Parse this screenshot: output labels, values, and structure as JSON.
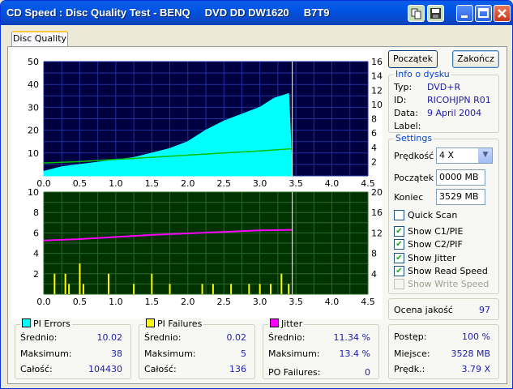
{
  "window": {
    "title": "CD Speed : Disc Quality Test - BENQ     DVD DD DW1620     B7T9"
  },
  "tab": {
    "label": "Disc Quality"
  },
  "buttons": {
    "start": "Początek",
    "stop": "Zakończ"
  },
  "disc_info": {
    "legend": "Info o dysku",
    "type_label": "Typ:",
    "type": "DVD+R",
    "id_label": "ID:",
    "id": "RICOHJPN R01",
    "date_label": "Data:",
    "date": "9 April 2004",
    "label_label": "Label:",
    "label": ""
  },
  "settings": {
    "legend": "Settings",
    "speed_label": "Prędkość",
    "speed": "4 X",
    "start_label": "Początek",
    "start": "0000 MB",
    "end_label": "Koniec",
    "end": "3529 MB",
    "quick_scan": "Quick Scan",
    "show_c1pie": "Show C1/PIE",
    "show_c2pif": "Show C2/PIF",
    "show_jitter": "Show Jitter",
    "show_read_speed": "Show Read Speed",
    "show_write_speed": "Show Write Speed"
  },
  "quality": {
    "label": "Ocena jakość",
    "value": "97"
  },
  "progress": {
    "progress_label": "Postęp:",
    "progress": "100 %",
    "position_label": "Miejsce:",
    "position": "3528 MB",
    "speed_label": "Prędk.:",
    "speed": "3.79 X"
  },
  "stats": {
    "pi_errors": {
      "legend": "PI Errors",
      "avg_label": "Średnio:",
      "avg": "10.02",
      "max_label": "Maksimum:",
      "max": "38",
      "total_label": "Całość:",
      "total": "104430"
    },
    "pi_failures": {
      "legend": "PI Failures",
      "avg_label": "Średnio:",
      "avg": "0.02",
      "max_label": "Maksimum:",
      "max": "5",
      "total_label": "Całość:",
      "total": "136"
    },
    "jitter": {
      "legend": "Jitter",
      "avg_label": "Średnio:",
      "avg": "11.34 %",
      "max_label": "Maksimum:",
      "max": "13.4 %",
      "po_label": "PO Failures:",
      "po": "0"
    }
  },
  "colors": {
    "pie": "#00ffff",
    "pif": "#ffff00",
    "jitter": "#ff00ff",
    "speed": "#00c000",
    "graph1_bg": "#000040",
    "graph2_bg": "#003300"
  },
  "chart_data": [
    {
      "type": "area",
      "x_ticks": [
        "0.0",
        "0.5",
        "1.0",
        "1.5",
        "2.0",
        "2.5",
        "3.0",
        "3.5",
        "4.0",
        "4.5"
      ],
      "y_left_ticks": [
        "50",
        "40",
        "30",
        "20",
        "10"
      ],
      "y_right_ticks": [
        "16",
        "14",
        "12",
        "10",
        "8",
        "6",
        "4",
        "2"
      ],
      "xlim": [
        0,
        4.5
      ],
      "ylim": [
        0,
        50
      ],
      "y2lim": [
        0,
        16
      ],
      "series": [
        {
          "values": [
            [
              0,
              2
            ],
            [
              0.25,
              4
            ],
            [
              0.5,
              5
            ],
            [
              0.75,
              6
            ],
            [
              1.0,
              7
            ],
            [
              1.25,
              8
            ],
            [
              1.5,
              10
            ],
            [
              1.75,
              12
            ],
            [
              2.0,
              15
            ],
            [
              2.25,
              20
            ],
            [
              2.5,
              24
            ],
            [
              2.75,
              27
            ],
            [
              3.0,
              30
            ],
            [
              3.2,
              34
            ],
            [
              3.4,
              36
            ],
            [
              3.45,
              0
            ]
          ]
        },
        {
          "values": [
            [
              0,
              1.8
            ],
            [
              0.5,
              2.0
            ],
            [
              1.0,
              2.3
            ],
            [
              1.5,
              2.6
            ],
            [
              2.0,
              2.9
            ],
            [
              2.5,
              3.2
            ],
            [
              3.0,
              3.5
            ],
            [
              3.45,
              3.8
            ]
          ]
        }
      ]
    },
    {
      "type": "line",
      "x_ticks": [
        "0.0",
        "0.5",
        "1.0",
        "1.5",
        "2.0",
        "2.5",
        "3.0",
        "3.5",
        "4.0",
        "4.5"
      ],
      "y_left_ticks": [
        "10",
        "8",
        "6",
        "4",
        "2"
      ],
      "y_right_ticks": [
        "20",
        "16",
        "12",
        "8",
        "4"
      ],
      "xlim": [
        0,
        4.5
      ],
      "ylim": [
        0,
        10
      ],
      "y2lim": [
        0,
        20
      ],
      "series": [
        {
          "values": [
            [
              0.15,
              2
            ],
            [
              0.3,
              2
            ],
            [
              0.35,
              1
            ],
            [
              0.5,
              3
            ],
            [
              0.55,
              1
            ],
            [
              0.9,
              2
            ],
            [
              1.25,
              1
            ],
            [
              1.5,
              2
            ],
            [
              1.75,
              1
            ],
            [
              2.2,
              1
            ],
            [
              2.35,
              1
            ],
            [
              2.6,
              1
            ],
            [
              2.85,
              1
            ],
            [
              3.0,
              1
            ],
            [
              3.15,
              1
            ],
            [
              3.3,
              2
            ],
            [
              3.4,
              1
            ]
          ]
        },
        {
          "values": [
            [
              0,
              10.5
            ],
            [
              0.5,
              10.8
            ],
            [
              1.0,
              11.2
            ],
            [
              1.5,
              11.6
            ],
            [
              2.0,
              11.9
            ],
            [
              2.5,
              12.2
            ],
            [
              3.0,
              12.5
            ],
            [
              3.45,
              12.6
            ]
          ]
        }
      ]
    }
  ]
}
